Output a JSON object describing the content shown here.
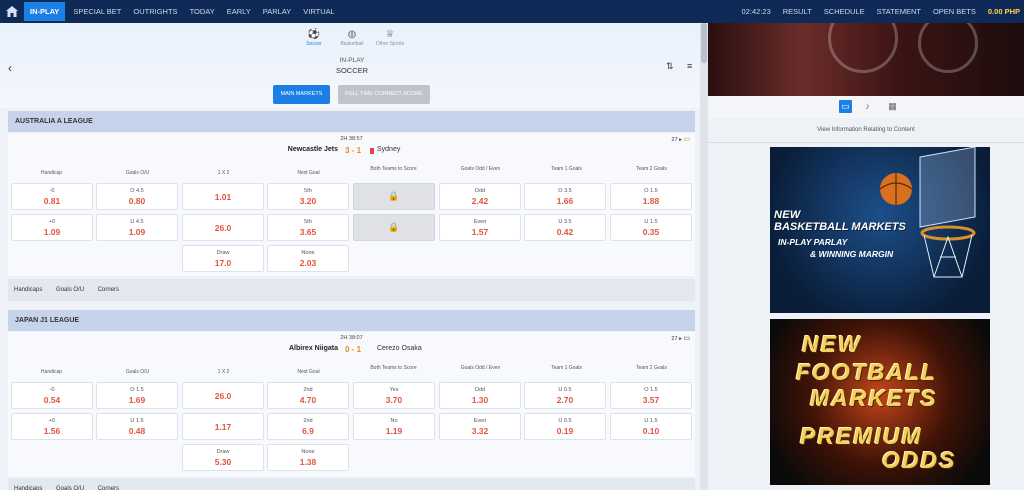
{
  "topnav": {
    "items": [
      "IN-PLAY",
      "SPECIAL BET",
      "OUTRIGHTS",
      "TODAY",
      "EARLY",
      "PARLAY",
      "VIRTUAL"
    ],
    "time": "02:42:23",
    "result": "RESULT",
    "schedule": "SCHEDULE",
    "statement": "STATEMENT",
    "open_bets": "OPEN BETS",
    "balance": "0.00 PHP"
  },
  "sports": {
    "soccer": "Soccer",
    "basketball": "Basketball",
    "other": "Other Sports",
    "inplay": "IN-PLAY",
    "current": "SOCCER"
  },
  "buttons": {
    "main_markets": "MAIN MARKETS",
    "full_time_correct_score": "FULL TIME CORRECT SCORE"
  },
  "headers": [
    "Handicap",
    "Goals O/U",
    "1 X 2",
    "Next Goal",
    "Both Teams to Score",
    "Goals Odd / Even",
    "Team 1 Goals",
    "Team 2 Goals"
  ],
  "match1": {
    "league": "AUSTRALIA A LEAGUE",
    "time": "2H 38:57",
    "home": "Newcastle Jets",
    "score_home": "3",
    "score_sep": "-",
    "score_away": "1",
    "away": "Sydney",
    "count": "27",
    "hc_labels": [
      "-0",
      "+0"
    ],
    "hc_odds": [
      "0.81",
      "1.09"
    ],
    "ou_labels": [
      "O 4.5",
      "U 4.5"
    ],
    "ou_odds": [
      "0.80",
      "1.09"
    ],
    "x12": [
      "1.01",
      "26.0"
    ],
    "draw_label": "Draw",
    "draw_odds": "17.0",
    "ng_labels": [
      "5th",
      "5th",
      "None"
    ],
    "ng_odds": [
      "3.20",
      "3.65",
      "2.03"
    ],
    "oe_labels": [
      "Odd",
      "Even"
    ],
    "oe_odds": [
      "2.42",
      "1.57"
    ],
    "t1_labels": [
      "O 3.5",
      "U 3.5"
    ],
    "t1_odds": [
      "1.66",
      "0.42"
    ],
    "t2_labels": [
      "O 1.5",
      "U 1.5"
    ],
    "t2_odds": [
      "1.88",
      "0.35"
    ]
  },
  "match2": {
    "league": "JAPAN J1 LEAGUE",
    "time": "2H 38:07",
    "home": "Albirex Niigata",
    "score_home": "0",
    "score_sep": "-",
    "score_away": "1",
    "away": "Cerezo Osaka",
    "count": "27",
    "hc_labels": [
      "-0",
      "+0"
    ],
    "hc_odds": [
      "0.54",
      "1.56"
    ],
    "ou_labels": [
      "O 1.5",
      "U 1.5"
    ],
    "ou_odds": [
      "1.69",
      "0.48"
    ],
    "x12": [
      "26.0",
      "1.17"
    ],
    "draw_label": "Draw",
    "draw_odds": "5.30",
    "ng_labels": [
      "2nd",
      "2nd",
      "None"
    ],
    "ng_odds": [
      "4.70",
      "6.9",
      "1.38"
    ],
    "bt_labels": [
      "Yes",
      "No"
    ],
    "bt_odds": [
      "3.70",
      "1.19"
    ],
    "oe_labels": [
      "Odd",
      "Even"
    ],
    "oe_odds": [
      "1.30",
      "3.32"
    ],
    "t1_labels": [
      "U 0.5",
      "U 0.5"
    ],
    "t1_odds": [
      "2.70",
      "0.19"
    ],
    "t2_labels": [
      "O 1.5",
      "U 1.5"
    ],
    "t2_odds": [
      "3.57",
      "0.10"
    ]
  },
  "market_tabs": [
    "Handicaps",
    "Goals O/U",
    "Corners"
  ],
  "side": {
    "view_info": "View Information Relating to Content",
    "banner1": {
      "line1": "NEW",
      "line2": "BASKETBALL MARKETS",
      "line3": "IN-PLAY PARLAY",
      "line4": "& WINNING MARGIN"
    },
    "banner2": {
      "line1": "NEW",
      "line2": "FOOTBALL",
      "line3": "MARKETS",
      "line4": "PREMIUM",
      "line5": "ODDS"
    }
  },
  "colors": {
    "nav_bg": "#0f2a57",
    "accent": "#1b7fe6",
    "odds": "#e0553f",
    "league_bar": "#c6d3ea"
  }
}
